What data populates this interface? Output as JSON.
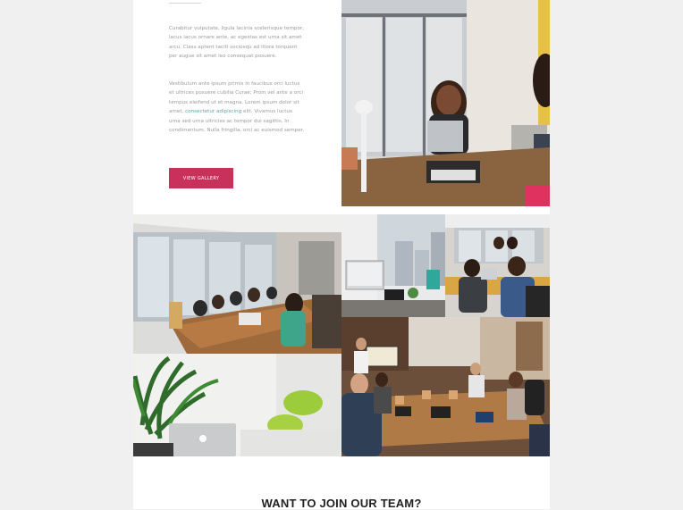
{
  "intro": {
    "paragraph1": "Curabitur vulputate, ligula lacinia scelerisque tempor, lacus lacus ornare ante, ac egestas est urna sit amet arcu. Class aptent taciti sociosqu ad litora torquent per augue sit amet leo consequat posuere.",
    "paragraph2_before": "Vestibulum ante ipsum primis in faucibus orci luctus et ultrices posuere cubilia Curae; Proin vel ante a orci tempus eleifend ut et magna. Lorem ipsum dolor sit amet, ",
    "paragraph2_link": "consectetur adipiscing",
    "paragraph2_after": " elit. Vivamus luctus urna sed urna ultricies ac tempor dui sagittis. In condimentum. Nulla fringilla, orci ac euismod semper.",
    "button_label": "VIEW GALLERY"
  },
  "gallery": {
    "photos": [
      {
        "name": "office-meeting-woman-laptop-photo"
      },
      {
        "name": "conference-room-table-photo"
      },
      {
        "name": "computer-desk-window-photo"
      },
      {
        "name": "women-laptop-meeting-photo"
      },
      {
        "name": "green-plant-laptop-photo"
      },
      {
        "name": "team-presentation-meeting-photo"
      }
    ]
  },
  "join": {
    "heading": "WANT TO JOIN OUR TEAM?"
  },
  "colors": {
    "accent_button": "#c8315a",
    "link": "#35b6a7",
    "body_text": "#9a9a9a",
    "page_background": "#f0f0f0"
  }
}
